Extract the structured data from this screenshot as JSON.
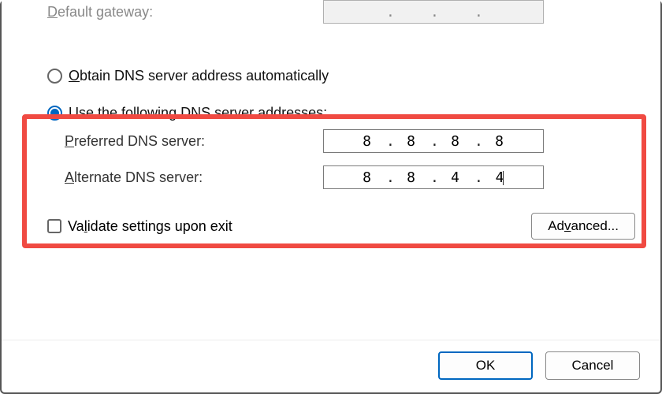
{
  "default_gateway": {
    "underline": "D",
    "rest": "efault gateway:",
    "octets": [
      "",
      "",
      "",
      ""
    ]
  },
  "dns_auto": {
    "underline": "O",
    "rest": "btain DNS server address automatically",
    "selected": false
  },
  "dns_manual": {
    "label_pre": "Use the following DNS ",
    "underline": "s",
    "label_post": "erver addresses:",
    "selected": true
  },
  "preferred": {
    "underline": "P",
    "rest": "referred DNS server:",
    "octets": [
      "8",
      "8",
      "8",
      "8"
    ]
  },
  "alternate": {
    "underline": "A",
    "rest": "lternate DNS server:",
    "octets": [
      "8",
      "8",
      "4",
      "4"
    ]
  },
  "validate": {
    "pre": "Va",
    "underline": "l",
    "post": "idate settings upon exit",
    "checked": false
  },
  "advanced": {
    "pre": "Ad",
    "underline": "v",
    "post": "anced..."
  },
  "buttons": {
    "ok": "OK",
    "cancel": "Cancel"
  }
}
